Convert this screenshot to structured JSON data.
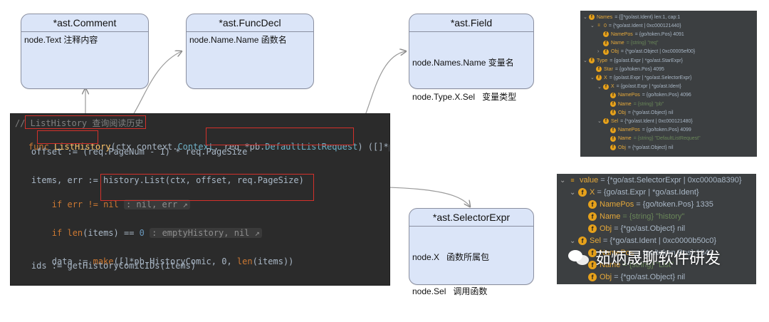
{
  "boxes": {
    "comment": {
      "title": "*ast.Comment",
      "lines": [
        "node.Text 注释内容"
      ]
    },
    "funcdecl": {
      "title": "*ast.FuncDecl",
      "lines": [
        "node.Name.Name 函数名"
      ]
    },
    "field": {
      "title": "*ast.Field",
      "lines": [
        "node.Names.Name 变量名",
        "node.Type.X.Sel   变量类型"
      ]
    },
    "selector": {
      "title": "*ast.SelectorExpr",
      "lines": [
        "node.X   函数所属包",
        "node.Sel   调用函数"
      ]
    }
  },
  "code": {
    "line1": "// ListHistory 查询阅读历史",
    "line2_kw": "func",
    "line2_name": "ListHistory",
    "line2_rest_a": "(ctx context.",
    "line2_ctx": "Context",
    "line2_rest_b": ", req *pb.",
    "line2_type": "DefaultListRequest",
    "line2_rest_c": ") ([]*pb",
    "line3": "    offset := (req.PageNum - 1) * req.PageSize",
    "line4": "    items, err := history.List(ctx, offset, req.PageSize)",
    "line5_a": "    if err != ",
    "line5_nil": "nil",
    "line5_hint": ": nil, err ↗",
    "line6_a": "    if ",
    "line6_len": "len",
    "line6_b": "(items) == ",
    "line6_zero": "0",
    "line6_hint": ": emptyHistory, nil ↗",
    "line7_a": "    data := ",
    "line7_make": "make",
    "line7_b": "([]*pb.HistoryComic, 0, ",
    "line7_len": "len",
    "line7_c": "(items))",
    "line8": "    ids := getHistoryComicIDs(items)"
  },
  "debug1": {
    "rows": [
      {
        "tw": "⌄",
        "icon": "f",
        "key": "Names",
        "val": "= {[]*go/ast.Ident} len:1, cap:1"
      },
      {
        "tw": "⌄",
        "icon": "≡",
        "key": "0",
        "val": "= {*go/ast.Ident | 0xc000121440}"
      },
      {
        "tw": "",
        "icon": "f",
        "key": "NamePos",
        "val": "= {go/token.Pos} 4091"
      },
      {
        "tw": "",
        "icon": "f",
        "key": "Name",
        "val": "= {string} \"req\""
      },
      {
        "tw": "›",
        "icon": "f",
        "key": "Obj",
        "val": "= {*go/ast.Object | 0xc00005ef00}"
      },
      {
        "tw": "⌄",
        "icon": "f",
        "key": "Type",
        "val": "= {go/ast.Expr | *go/ast.StarExpr}"
      },
      {
        "tw": "",
        "icon": "f",
        "key": "Star",
        "val": "= {go/token.Pos} 4095"
      },
      {
        "tw": "⌄",
        "icon": "f",
        "key": "X",
        "val": "= {go/ast.Expr | *go/ast.SelectorExpr}"
      },
      {
        "tw": "⌄",
        "icon": "f",
        "key": "X",
        "val": "= {go/ast.Expr | *go/ast.Ident}"
      },
      {
        "tw": "",
        "icon": "f",
        "key": "NamePos",
        "val": "= {go/token.Pos} 4096"
      },
      {
        "tw": "",
        "icon": "f",
        "key": "Name",
        "val": "= {string} \"pb\""
      },
      {
        "tw": "",
        "icon": "f",
        "key": "Obj",
        "val": "= {*go/ast.Object} nil"
      },
      {
        "tw": "⌄",
        "icon": "f",
        "key": "Sel",
        "val": "= {*go/ast.Ident | 0xc000121480}"
      },
      {
        "tw": "",
        "icon": "f",
        "key": "NamePos",
        "val": "= {go/token.Pos} 4099"
      },
      {
        "tw": "",
        "icon": "f",
        "key": "Name",
        "val": "= {string} \"DefaultListRequest\""
      },
      {
        "tw": "",
        "icon": "f",
        "key": "Obj",
        "val": "= {*go/ast.Object} nil"
      }
    ]
  },
  "debug2": {
    "rows": [
      {
        "tw": "⌄",
        "icon": "≡",
        "key": "value",
        "val": "= {*go/ast.SelectorExpr | 0xc0000a8390}"
      },
      {
        "tw": "⌄",
        "icon": "f",
        "key": "X",
        "val": "= {go/ast.Expr | *go/ast.Ident}"
      },
      {
        "tw": "",
        "icon": "f",
        "key": "NamePos",
        "val": "= {go/token.Pos} 1335"
      },
      {
        "tw": "",
        "icon": "f",
        "key": "Name",
        "val": "= {string} \"history\""
      },
      {
        "tw": "",
        "icon": "f",
        "key": "Obj",
        "val": "= {*go/ast.Object} nil"
      },
      {
        "tw": "⌄",
        "icon": "f",
        "key": "Sel",
        "val": "= {*go/ast.Ident | 0xc0000b50c0}"
      },
      {
        "tw": "",
        "icon": "f",
        "key": "NamePos",
        "val": "= {go/token.Pos} 1342"
      },
      {
        "tw": "",
        "icon": "f",
        "key": "Name",
        "val": "= {string} \"List\""
      },
      {
        "tw": "",
        "icon": "f",
        "key": "Obj",
        "val": "= {*go/ast.Object} nil"
      }
    ]
  },
  "watermark": {
    "text": "茹炳晟聊软件研发"
  },
  "colors": {
    "box_fill": "#dbe5f8",
    "highlight": "#d4312b",
    "code_bg": "#2b2b2b",
    "debug_bg": "#3c3f41",
    "field_icon": "#e6a11b"
  }
}
